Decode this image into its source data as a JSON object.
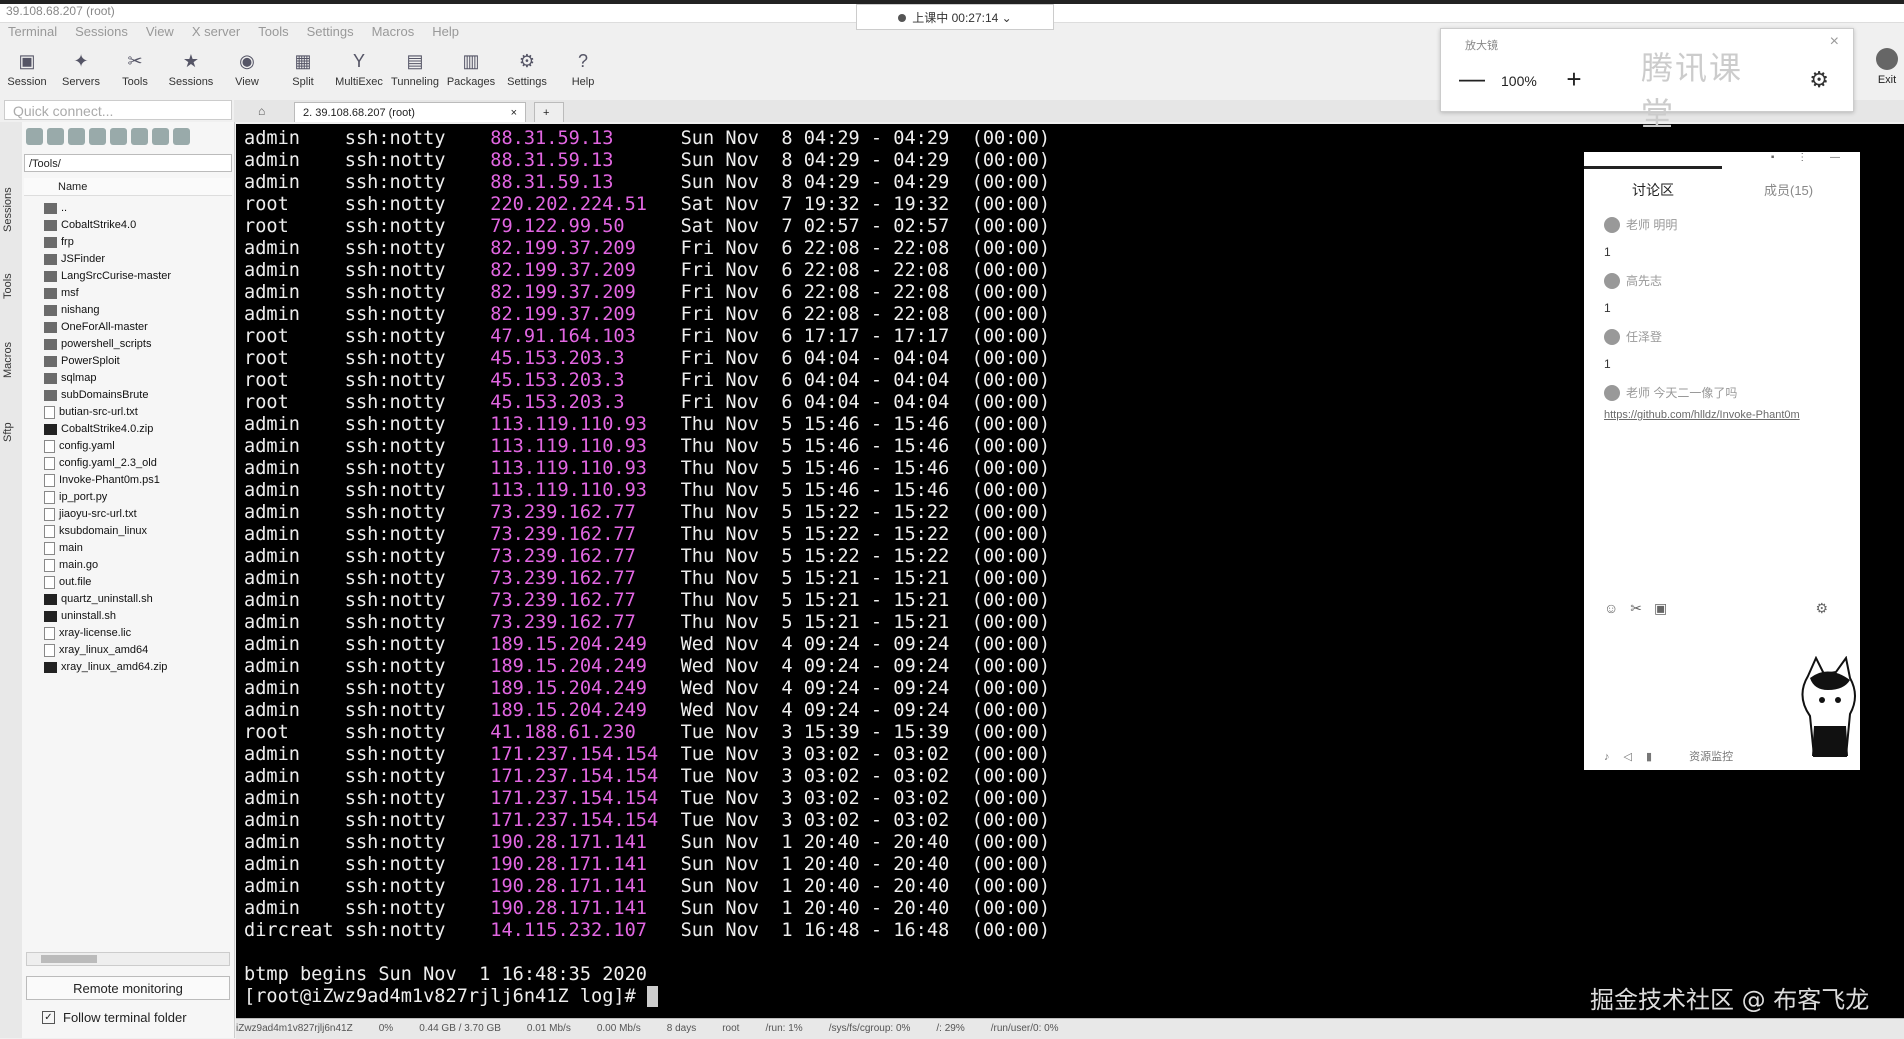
{
  "window": {
    "title": "39.108.68.207 (root)"
  },
  "menu": [
    "Terminal",
    "Sessions",
    "View",
    "X server",
    "Tools",
    "Settings",
    "Macros",
    "Help"
  ],
  "toolbar": [
    {
      "label": "Session",
      "icon": "session-icon"
    },
    {
      "label": "Servers",
      "icon": "servers-icon"
    },
    {
      "label": "Tools",
      "icon": "tools-icon"
    },
    {
      "label": "Sessions",
      "icon": "sessions-icon"
    },
    {
      "label": "View",
      "icon": "view-icon"
    },
    {
      "label": "Split",
      "icon": "split-icon"
    },
    {
      "label": "MultiExec",
      "icon": "multiexec-icon"
    },
    {
      "label": "Tunneling",
      "icon": "tunneling-icon"
    },
    {
      "label": "Packages",
      "icon": "packages-icon"
    },
    {
      "label": "Settings",
      "icon": "settings-icon"
    },
    {
      "label": "Help",
      "icon": "help-icon"
    }
  ],
  "exit_label": "Exit",
  "quick_connect": {
    "placeholder": "Quick connect..."
  },
  "side_tabs": [
    "Sessions",
    "Tools",
    "Macros",
    "Sftp"
  ],
  "sftp": {
    "path": "/Tools/",
    "column_name": "Name",
    "files": [
      {
        "name": "..",
        "type": "folder"
      },
      {
        "name": "CobaltStrike4.0",
        "type": "folder"
      },
      {
        "name": "frp",
        "type": "folder"
      },
      {
        "name": "JSFinder",
        "type": "folder"
      },
      {
        "name": "LangSrcCurise-master",
        "type": "folder"
      },
      {
        "name": "msf",
        "type": "folder"
      },
      {
        "name": "nishang",
        "type": "folder"
      },
      {
        "name": "OneForAll-master",
        "type": "folder"
      },
      {
        "name": "powershell_scripts",
        "type": "folder"
      },
      {
        "name": "PowerSploit",
        "type": "folder"
      },
      {
        "name": "sqlmap",
        "type": "folder"
      },
      {
        "name": "subDomainsBrute",
        "type": "folder"
      },
      {
        "name": "butian-src-url.txt",
        "type": "doc"
      },
      {
        "name": "CobaltStrike4.0.zip",
        "type": "exe"
      },
      {
        "name": "config.yaml",
        "type": "doc"
      },
      {
        "name": "config.yaml_2.3_old",
        "type": "doc"
      },
      {
        "name": "Invoke-Phant0m.ps1",
        "type": "doc"
      },
      {
        "name": "ip_port.py",
        "type": "doc"
      },
      {
        "name": "jiaoyu-src-url.txt",
        "type": "doc"
      },
      {
        "name": "ksubdomain_linux",
        "type": "doc"
      },
      {
        "name": "main",
        "type": "doc"
      },
      {
        "name": "main.go",
        "type": "doc"
      },
      {
        "name": "out.file",
        "type": "doc"
      },
      {
        "name": "quartz_uninstall.sh",
        "type": "exe"
      },
      {
        "name": "uninstall.sh",
        "type": "exe"
      },
      {
        "name": "xray-license.lic",
        "type": "doc"
      },
      {
        "name": "xray_linux_amd64",
        "type": "doc"
      },
      {
        "name": "xray_linux_amd64.zip",
        "type": "exe"
      }
    ],
    "remote_monitoring": "Remote monitoring",
    "follow_folder": "Follow terminal folder"
  },
  "tabs": [
    {
      "label": "2. 39.108.68.207 (root)"
    }
  ],
  "terminal": {
    "rows": [
      [
        "admin",
        "ssh:notty",
        "88.31.59.13",
        "Sun Nov  8 04:29 - 04:29  (00:00)"
      ],
      [
        "admin",
        "ssh:notty",
        "88.31.59.13",
        "Sun Nov  8 04:29 - 04:29  (00:00)"
      ],
      [
        "admin",
        "ssh:notty",
        "88.31.59.13",
        "Sun Nov  8 04:29 - 04:29  (00:00)"
      ],
      [
        "root",
        "ssh:notty",
        "220.202.224.51",
        "Sat Nov  7 19:32 - 19:32  (00:00)"
      ],
      [
        "root",
        "ssh:notty",
        "79.122.99.50",
        "Sat Nov  7 02:57 - 02:57  (00:00)"
      ],
      [
        "admin",
        "ssh:notty",
        "82.199.37.209",
        "Fri Nov  6 22:08 - 22:08  (00:00)"
      ],
      [
        "admin",
        "ssh:notty",
        "82.199.37.209",
        "Fri Nov  6 22:08 - 22:08  (00:00)"
      ],
      [
        "admin",
        "ssh:notty",
        "82.199.37.209",
        "Fri Nov  6 22:08 - 22:08  (00:00)"
      ],
      [
        "admin",
        "ssh:notty",
        "82.199.37.209",
        "Fri Nov  6 22:08 - 22:08  (00:00)"
      ],
      [
        "root",
        "ssh:notty",
        "47.91.164.103",
        "Fri Nov  6 17:17 - 17:17  (00:00)"
      ],
      [
        "root",
        "ssh:notty",
        "45.153.203.3",
        "Fri Nov  6 04:04 - 04:04  (00:00)"
      ],
      [
        "root",
        "ssh:notty",
        "45.153.203.3",
        "Fri Nov  6 04:04 - 04:04  (00:00)"
      ],
      [
        "root",
        "ssh:notty",
        "45.153.203.3",
        "Fri Nov  6 04:04 - 04:04  (00:00)"
      ],
      [
        "admin",
        "ssh:notty",
        "113.119.110.93",
        "Thu Nov  5 15:46 - 15:46  (00:00)"
      ],
      [
        "admin",
        "ssh:notty",
        "113.119.110.93",
        "Thu Nov  5 15:46 - 15:46  (00:00)"
      ],
      [
        "admin",
        "ssh:notty",
        "113.119.110.93",
        "Thu Nov  5 15:46 - 15:46  (00:00)"
      ],
      [
        "admin",
        "ssh:notty",
        "113.119.110.93",
        "Thu Nov  5 15:46 - 15:46  (00:00)"
      ],
      [
        "admin",
        "ssh:notty",
        "73.239.162.77",
        "Thu Nov  5 15:22 - 15:22  (00:00)"
      ],
      [
        "admin",
        "ssh:notty",
        "73.239.162.77",
        "Thu Nov  5 15:22 - 15:22  (00:00)"
      ],
      [
        "admin",
        "ssh:notty",
        "73.239.162.77",
        "Thu Nov  5 15:22 - 15:22  (00:00)"
      ],
      [
        "admin",
        "ssh:notty",
        "73.239.162.77",
        "Thu Nov  5 15:21 - 15:21  (00:00)"
      ],
      [
        "admin",
        "ssh:notty",
        "73.239.162.77",
        "Thu Nov  5 15:21 - 15:21  (00:00)"
      ],
      [
        "admin",
        "ssh:notty",
        "73.239.162.77",
        "Thu Nov  5 15:21 - 15:21  (00:00)"
      ],
      [
        "admin",
        "ssh:notty",
        "189.15.204.249",
        "Wed Nov  4 09:24 - 09:24  (00:00)"
      ],
      [
        "admin",
        "ssh:notty",
        "189.15.204.249",
        "Wed Nov  4 09:24 - 09:24  (00:00)"
      ],
      [
        "admin",
        "ssh:notty",
        "189.15.204.249",
        "Wed Nov  4 09:24 - 09:24  (00:00)"
      ],
      [
        "admin",
        "ssh:notty",
        "189.15.204.249",
        "Wed Nov  4 09:24 - 09:24  (00:00)"
      ],
      [
        "root",
        "ssh:notty",
        "41.188.61.230",
        "Tue Nov  3 15:39 - 15:39  (00:00)"
      ],
      [
        "admin",
        "ssh:notty",
        "171.237.154.154",
        "Tue Nov  3 03:02 - 03:02  (00:00)"
      ],
      [
        "admin",
        "ssh:notty",
        "171.237.154.154",
        "Tue Nov  3 03:02 - 03:02  (00:00)"
      ],
      [
        "admin",
        "ssh:notty",
        "171.237.154.154",
        "Tue Nov  3 03:02 - 03:02  (00:00)"
      ],
      [
        "admin",
        "ssh:notty",
        "171.237.154.154",
        "Tue Nov  3 03:02 - 03:02  (00:00)"
      ],
      [
        "admin",
        "ssh:notty",
        "190.28.171.141",
        "Sun Nov  1 20:40 - 20:40  (00:00)"
      ],
      [
        "admin",
        "ssh:notty",
        "190.28.171.141",
        "Sun Nov  1 20:40 - 20:40  (00:00)"
      ],
      [
        "admin",
        "ssh:notty",
        "190.28.171.141",
        "Sun Nov  1 20:40 - 20:40  (00:00)"
      ],
      [
        "admin",
        "ssh:notty",
        "190.28.171.141",
        "Sun Nov  1 20:40 - 20:40  (00:00)"
      ],
      [
        "dircreat",
        "ssh:notty",
        "14.115.232.107",
        "Sun Nov  1 16:48 - 16:48  (00:00)"
      ]
    ],
    "footer": "btmp begins Sun Nov  1 16:48:35 2020",
    "prompt": "[root@iZwz9ad4m1v827rjlj6n41Z log]# ",
    "ip_color": "#e266e2"
  },
  "statusbar": [
    "iZwz9ad4m1v827rjlj6n41Z",
    "0%",
    "0.44 GB / 3.70 GB",
    "0.01 Mb/s",
    "0.00 Mb/s",
    "8 days",
    "root",
    "/run: 1%",
    "/sys/fs/cgroup: 0%",
    "/: 29%",
    "/run/user/0: 0%"
  ],
  "recording": {
    "label": "上课中 00:27:14"
  },
  "magnifier": {
    "title": "放大镜",
    "zoom": "100%",
    "logo": "腾讯课堂"
  },
  "chat": {
    "tab_discussion": "讨论区",
    "tab_members": "成员(15)",
    "messages": [
      {
        "name": "老师 明明",
        "text": "1"
      },
      {
        "name": "高先志",
        "text": "1"
      },
      {
        "name": "任泽登",
        "text": "1"
      },
      {
        "name": "老师 今天二一像了吗",
        "link": "https://github.com/hlldz/Invoke-Phant0m"
      }
    ],
    "bottom_label": "资源监控"
  },
  "watermark": "掘金技术社区 @ 布客飞龙"
}
